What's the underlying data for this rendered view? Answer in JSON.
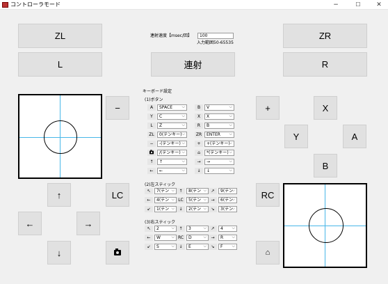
{
  "window": {
    "title": "コントローラモード",
    "minimize": "−",
    "maximize": "☐",
    "close": "✕"
  },
  "buttons": {
    "zl": "ZL",
    "zr": "ZR",
    "l": "L",
    "r": "R",
    "rapid_fire": "連射",
    "minus": "−",
    "plus": "+",
    "x": "X",
    "y": "Y",
    "a": "A",
    "b": "B",
    "lc": "LC",
    "rc": "RC",
    "up": "↑",
    "down": "↓",
    "left": "←",
    "right": "→"
  },
  "rapid": {
    "label": "連射速度【msec/回】",
    "value": "100",
    "range_label": "入力範囲50-65535"
  },
  "keyboard": {
    "title": "キーボード設定",
    "buttons_title": "(1)ボタン",
    "button_rows": [
      {
        "k1": "A",
        "v1": "SPACE",
        "k2": "B",
        "v2": "V"
      },
      {
        "k1": "Y",
        "v1": "C",
        "k2": "X",
        "v2": "X"
      },
      {
        "k1": "L",
        "v1": "Z",
        "k2": "R",
        "v2": "B"
      },
      {
        "k1": "ZL",
        "v1": "0(テンキー)",
        "k2": "ZR",
        "v2": "ENTER"
      },
      {
        "k1": "−",
        "v1": "-(テンキー)",
        "k2": "+",
        "v2": "+(テンキー)"
      },
      {
        "k1": "cam",
        "v1": "/(テンキー)",
        "k2": "home",
        "v2": "*(テンキー)"
      },
      {
        "k1": "↑",
        "v1": "↑",
        "k2": "→",
        "v2": "→"
      },
      {
        "k1": "←",
        "v1": "←",
        "k2": "↓",
        "v2": "↓"
      }
    ],
    "lstick_title": "(2)左スティック",
    "lstick_rows": [
      {
        "k1": "↖",
        "v1": "7(テン",
        "k2": "↑",
        "v2": "8(テン",
        "k3": "↗",
        "v3": "9(テン"
      },
      {
        "k1": "←",
        "v1": "4(テン",
        "k2": "LC",
        "v2": "5(テン",
        "k3": "→",
        "v3": "6(テン"
      },
      {
        "k1": "↙",
        "v1": "1(テン",
        "k2": "↓",
        "v2": "2(テン",
        "k3": "↘",
        "v3": "3(テン"
      }
    ],
    "rstick_title": "(3)右スティック",
    "rstick_rows": [
      {
        "k1": "↖",
        "v1": "2",
        "k2": "↑",
        "v2": "3",
        "k3": "↗",
        "v3": "4"
      },
      {
        "k1": "←",
        "v1": "W",
        "k2": "RC",
        "v2": "D",
        "k3": "→",
        "v3": "R"
      },
      {
        "k1": "↙",
        "v1": "S",
        "k2": "↓",
        "v2": "E",
        "k3": "↘",
        "v3": "F"
      }
    ]
  }
}
